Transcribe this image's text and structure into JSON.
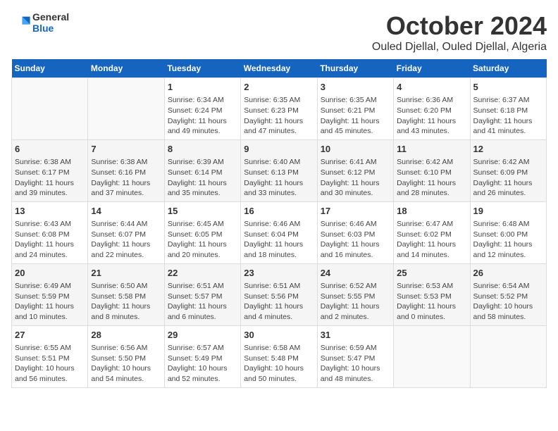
{
  "logo": {
    "general": "General",
    "blue": "Blue"
  },
  "header": {
    "title": "October 2024",
    "subtitle": "Ouled Djellal, Ouled Djellal, Algeria"
  },
  "days_of_week": [
    "Sunday",
    "Monday",
    "Tuesday",
    "Wednesday",
    "Thursday",
    "Friday",
    "Saturday"
  ],
  "weeks": [
    [
      {
        "day": "",
        "info": ""
      },
      {
        "day": "",
        "info": ""
      },
      {
        "day": "1",
        "info": "Sunrise: 6:34 AM\nSunset: 6:24 PM\nDaylight: 11 hours and 49 minutes."
      },
      {
        "day": "2",
        "info": "Sunrise: 6:35 AM\nSunset: 6:23 PM\nDaylight: 11 hours and 47 minutes."
      },
      {
        "day": "3",
        "info": "Sunrise: 6:35 AM\nSunset: 6:21 PM\nDaylight: 11 hours and 45 minutes."
      },
      {
        "day": "4",
        "info": "Sunrise: 6:36 AM\nSunset: 6:20 PM\nDaylight: 11 hours and 43 minutes."
      },
      {
        "day": "5",
        "info": "Sunrise: 6:37 AM\nSunset: 6:18 PM\nDaylight: 11 hours and 41 minutes."
      }
    ],
    [
      {
        "day": "6",
        "info": "Sunrise: 6:38 AM\nSunset: 6:17 PM\nDaylight: 11 hours and 39 minutes."
      },
      {
        "day": "7",
        "info": "Sunrise: 6:38 AM\nSunset: 6:16 PM\nDaylight: 11 hours and 37 minutes."
      },
      {
        "day": "8",
        "info": "Sunrise: 6:39 AM\nSunset: 6:14 PM\nDaylight: 11 hours and 35 minutes."
      },
      {
        "day": "9",
        "info": "Sunrise: 6:40 AM\nSunset: 6:13 PM\nDaylight: 11 hours and 33 minutes."
      },
      {
        "day": "10",
        "info": "Sunrise: 6:41 AM\nSunset: 6:12 PM\nDaylight: 11 hours and 30 minutes."
      },
      {
        "day": "11",
        "info": "Sunrise: 6:42 AM\nSunset: 6:10 PM\nDaylight: 11 hours and 28 minutes."
      },
      {
        "day": "12",
        "info": "Sunrise: 6:42 AM\nSunset: 6:09 PM\nDaylight: 11 hours and 26 minutes."
      }
    ],
    [
      {
        "day": "13",
        "info": "Sunrise: 6:43 AM\nSunset: 6:08 PM\nDaylight: 11 hours and 24 minutes."
      },
      {
        "day": "14",
        "info": "Sunrise: 6:44 AM\nSunset: 6:07 PM\nDaylight: 11 hours and 22 minutes."
      },
      {
        "day": "15",
        "info": "Sunrise: 6:45 AM\nSunset: 6:05 PM\nDaylight: 11 hours and 20 minutes."
      },
      {
        "day": "16",
        "info": "Sunrise: 6:46 AM\nSunset: 6:04 PM\nDaylight: 11 hours and 18 minutes."
      },
      {
        "day": "17",
        "info": "Sunrise: 6:46 AM\nSunset: 6:03 PM\nDaylight: 11 hours and 16 minutes."
      },
      {
        "day": "18",
        "info": "Sunrise: 6:47 AM\nSunset: 6:02 PM\nDaylight: 11 hours and 14 minutes."
      },
      {
        "day": "19",
        "info": "Sunrise: 6:48 AM\nSunset: 6:00 PM\nDaylight: 11 hours and 12 minutes."
      }
    ],
    [
      {
        "day": "20",
        "info": "Sunrise: 6:49 AM\nSunset: 5:59 PM\nDaylight: 11 hours and 10 minutes."
      },
      {
        "day": "21",
        "info": "Sunrise: 6:50 AM\nSunset: 5:58 PM\nDaylight: 11 hours and 8 minutes."
      },
      {
        "day": "22",
        "info": "Sunrise: 6:51 AM\nSunset: 5:57 PM\nDaylight: 11 hours and 6 minutes."
      },
      {
        "day": "23",
        "info": "Sunrise: 6:51 AM\nSunset: 5:56 PM\nDaylight: 11 hours and 4 minutes."
      },
      {
        "day": "24",
        "info": "Sunrise: 6:52 AM\nSunset: 5:55 PM\nDaylight: 11 hours and 2 minutes."
      },
      {
        "day": "25",
        "info": "Sunrise: 6:53 AM\nSunset: 5:53 PM\nDaylight: 11 hours and 0 minutes."
      },
      {
        "day": "26",
        "info": "Sunrise: 6:54 AM\nSunset: 5:52 PM\nDaylight: 10 hours and 58 minutes."
      }
    ],
    [
      {
        "day": "27",
        "info": "Sunrise: 6:55 AM\nSunset: 5:51 PM\nDaylight: 10 hours and 56 minutes."
      },
      {
        "day": "28",
        "info": "Sunrise: 6:56 AM\nSunset: 5:50 PM\nDaylight: 10 hours and 54 minutes."
      },
      {
        "day": "29",
        "info": "Sunrise: 6:57 AM\nSunset: 5:49 PM\nDaylight: 10 hours and 52 minutes."
      },
      {
        "day": "30",
        "info": "Sunrise: 6:58 AM\nSunset: 5:48 PM\nDaylight: 10 hours and 50 minutes."
      },
      {
        "day": "31",
        "info": "Sunrise: 6:59 AM\nSunset: 5:47 PM\nDaylight: 10 hours and 48 minutes."
      },
      {
        "day": "",
        "info": ""
      },
      {
        "day": "",
        "info": ""
      }
    ]
  ]
}
